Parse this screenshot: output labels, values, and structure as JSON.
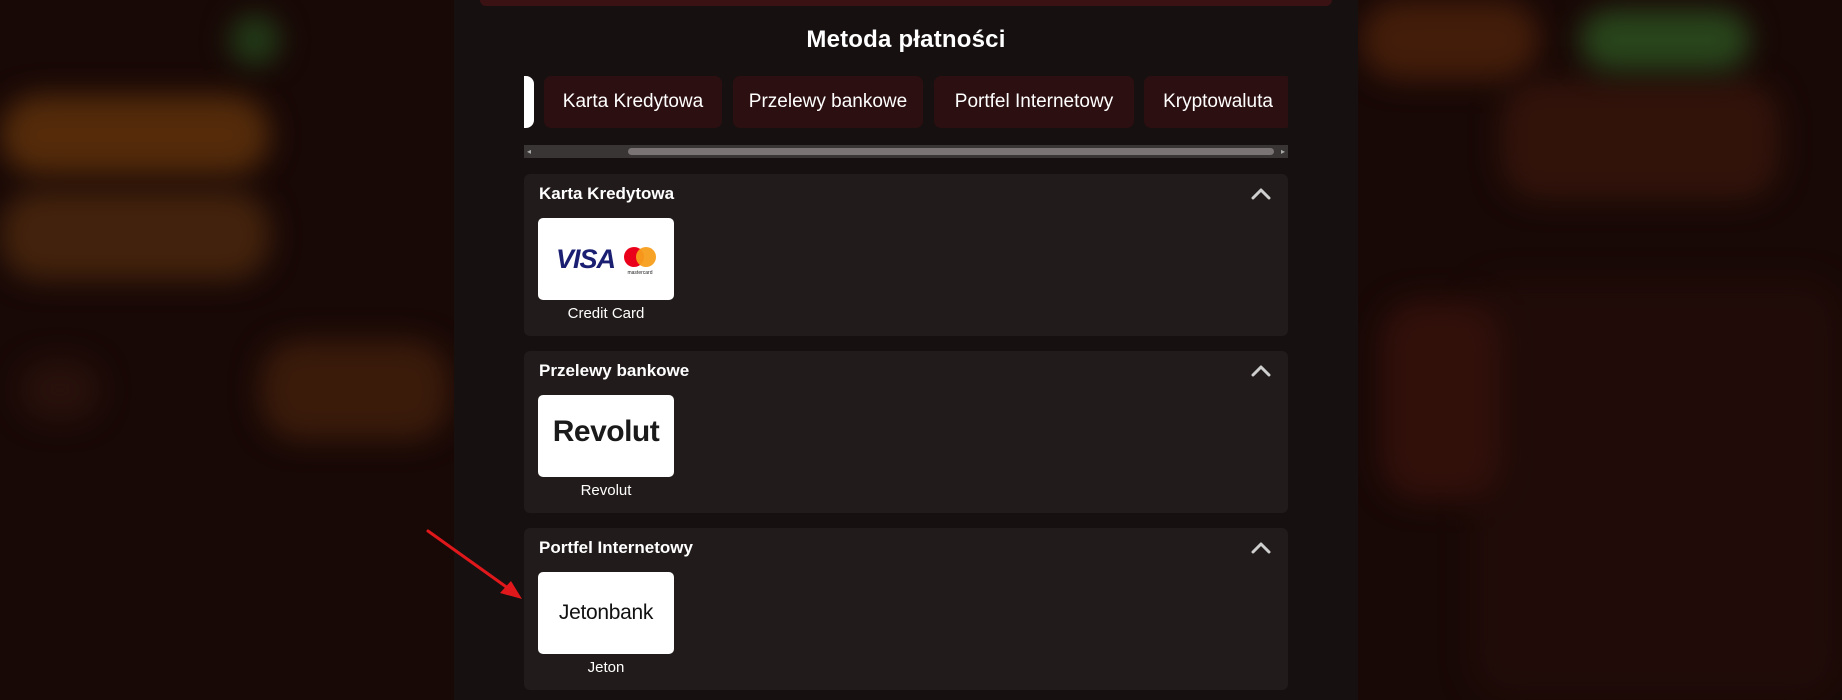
{
  "modal": {
    "title": "Metoda płatności"
  },
  "tabs": [
    {
      "label": "Karta Kredytowa"
    },
    {
      "label": "Przelewy bankowe"
    },
    {
      "label": "Portfel Internetowy"
    },
    {
      "label": "Kryptowaluta"
    }
  ],
  "sections": [
    {
      "title": "Karta Kredytowa",
      "methods": [
        {
          "name": "Credit Card",
          "logo": "visa-mastercard-logo",
          "logo_text": "VISA",
          "logo_subtext": "mastercard"
        }
      ]
    },
    {
      "title": "Przelewy bankowe",
      "methods": [
        {
          "name": "Revolut",
          "logo": "revolut-logo",
          "logo_text": "Revolut"
        }
      ]
    },
    {
      "title": "Portfel Internetowy",
      "methods": [
        {
          "name": "Jeton",
          "logo": "jetonbank-logo",
          "logo_text": "Jetonbank"
        }
      ]
    }
  ],
  "icons": {
    "collapse": "chevron-up-icon",
    "annotation": "red-arrow-annotation"
  },
  "colors": {
    "modal_bg": "#161010",
    "section_bg": "#221b1b",
    "tab_bg": "#2c0f10",
    "annotation_arrow": "#e0181b",
    "visa_blue": "#1a1f71",
    "mc_red": "#eb001b",
    "mc_orange": "#f79e1b"
  }
}
